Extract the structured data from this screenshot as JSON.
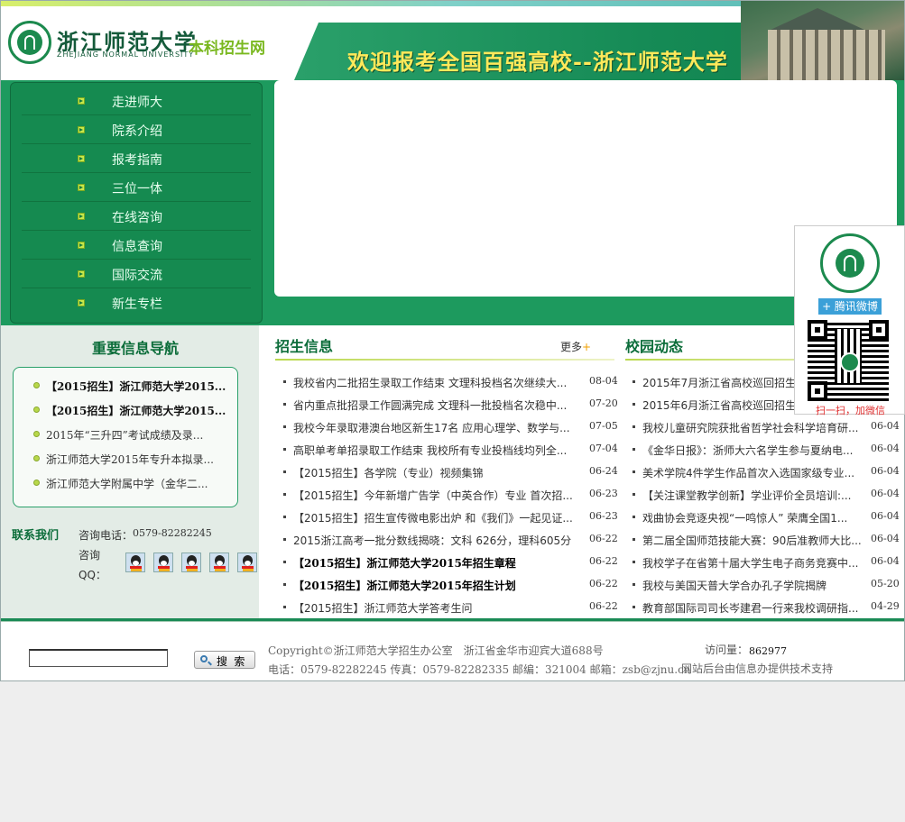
{
  "header": {
    "school_name": "浙江师范大学",
    "school_name_en": "ZHEJIANG NORMAL UNIVERSITY",
    "site_name": "本科招生网",
    "slogan": "欢迎报考全国百强高校--浙江师范大学"
  },
  "nav": {
    "items": [
      "走进师大",
      "院系介绍",
      "报考指南",
      "三位一体",
      "在线咨询",
      "信息查询",
      "国际交流",
      "新生专栏"
    ]
  },
  "important_nav": {
    "title": "重要信息导航",
    "items": [
      {
        "text": "【2015招生】浙江师范大学2015...",
        "bold": true
      },
      {
        "text": "【2015招生】浙江师范大学2015...",
        "bold": true
      },
      {
        "text": "2015年“三升四”考试成绩及录...",
        "bold": false
      },
      {
        "text": "浙江师范大学2015年专升本拟录...",
        "bold": false
      },
      {
        "text": "浙江师范大学附属中学（金华二...",
        "bold": false
      }
    ]
  },
  "contact": {
    "title": "联系我们",
    "tel_label": "咨询电话：",
    "tel_value": "0579-82282245",
    "qq_label": "咨询QQ：",
    "qq_icon": "qq-penguin-icon"
  },
  "admissions": {
    "title": "招生信息",
    "more_label": "更多",
    "more_plus": "+",
    "items": [
      {
        "title": "我校省内二批招生录取工作结束 文理科投档名次继续大...",
        "date": "08-04"
      },
      {
        "title": "省内重点批招录工作圆满完成 文理科一批投档名次稳中...",
        "date": "07-20"
      },
      {
        "title": "我校今年录取港澳台地区新生17名 应用心理学、数学与...",
        "date": "07-05"
      },
      {
        "title": "高职单考单招录取工作结束 我校所有专业投档线均列全...",
        "date": "07-04"
      },
      {
        "title": "【2015招生】各学院（专业）视频集锦",
        "date": "06-24"
      },
      {
        "title": "【2015招生】今年新增广告学（中英合作）专业 首次招...",
        "date": "06-23"
      },
      {
        "title": "【2015招生】招生宣传微电影出炉 和《我们》一起见证...",
        "date": "06-23"
      },
      {
        "title": "2015浙江高考一批分数线揭晓：文科 626分，理科605分",
        "date": "06-22"
      },
      {
        "title": "【2015招生】浙江师范大学2015年招生章程",
        "date": "06-22",
        "bold": true
      },
      {
        "title": "【2015招生】浙江师范大学2015年招生计划",
        "date": "06-22",
        "bold": true
      },
      {
        "title": "【2015招生】浙江师范大学答考生问",
        "date": "06-22"
      }
    ]
  },
  "campus": {
    "title": "校园动态",
    "items": [
      {
        "title": "2015年7月浙江省高校巡回招生咨",
        "date": ""
      },
      {
        "title": "2015年6月浙江省高校巡回招生咨",
        "date": ""
      },
      {
        "title": "我校儿童研究院获批省哲学社会科学培育研...",
        "date": "06-04"
      },
      {
        "title": "《金华日报》：浙师大六名学生参与夏纳电...",
        "date": "06-04"
      },
      {
        "title": "美术学院4件学生作品首次入选国家级专业...",
        "date": "06-04"
      },
      {
        "title": "【关注课堂教学创新】学业评价全员培训:...",
        "date": "06-04"
      },
      {
        "title": "戏曲协会竞逐央视“一鸣惊人” 荣膺全国1...",
        "date": "06-04"
      },
      {
        "title": "第二届全国师范技能大赛：90后准教师大比...",
        "date": "06-04"
      },
      {
        "title": "我校学子在省第十届大学生电子商务竞赛中...",
        "date": "06-04"
      },
      {
        "title": "我校与美国天普大学合办孔子学院揭牌",
        "date": "05-20"
      },
      {
        "title": "教育部国际司司长岑建君一行来我校调研指...",
        "date": "04-29"
      }
    ]
  },
  "footer": {
    "search_value": "",
    "search_button": "搜 索",
    "copyright": "Copyright©浙江师范大学招生办公室　浙江省金华市迎宾大道688号",
    "contact_info": "电话：0579-82282245  传真：0579-82282335  邮编：321004  邮箱：zsb@zjnu.cn",
    "visits_label": "访问量：",
    "visits_count": "862977",
    "support": "网站后台由信息办提供技术支持"
  },
  "widget": {
    "weibo_label": "+ 腾讯微博",
    "scan_text": "扫一扫，加微信"
  },
  "colors": {
    "brand_green": "#1d9a5e",
    "slogan_yellow": "#ffe95a",
    "accent_lime": "#b9d84c"
  }
}
